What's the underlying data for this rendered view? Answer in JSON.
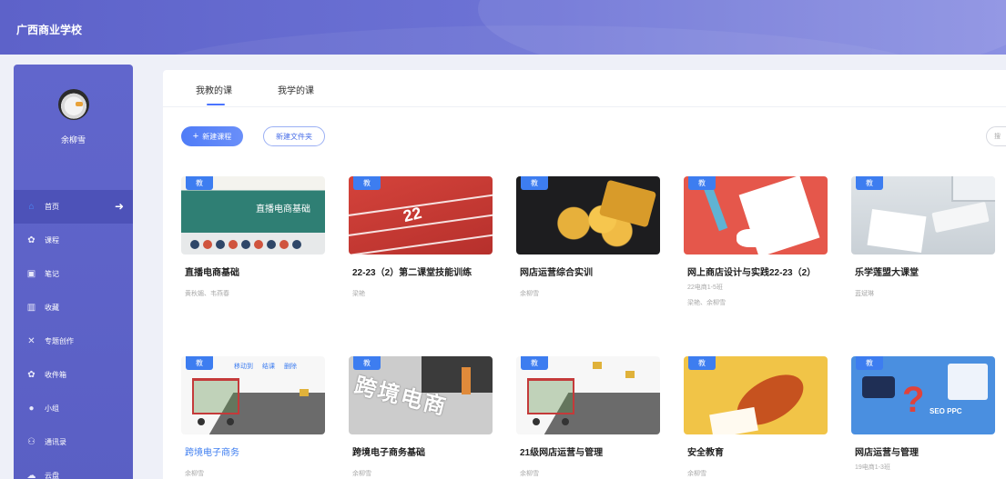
{
  "header": {
    "school_name": "广西商业学校"
  },
  "sidebar": {
    "user_name": "余柳雪",
    "items": [
      {
        "label": "首页",
        "icon": "home-icon",
        "active": true
      },
      {
        "label": "课程",
        "icon": "course-icon"
      },
      {
        "label": "笔记",
        "icon": "notes-icon"
      },
      {
        "label": "收藏",
        "icon": "favorites-icon"
      },
      {
        "label": "专题创作",
        "icon": "tools-icon"
      },
      {
        "label": "收件箱",
        "icon": "inbox-icon"
      },
      {
        "label": "小组",
        "icon": "group-icon"
      },
      {
        "label": "通讯录",
        "icon": "contacts-icon"
      },
      {
        "label": "云盘",
        "icon": "cloud-icon"
      }
    ]
  },
  "tabs": [
    {
      "label": "我教的课",
      "active": true
    },
    {
      "label": "我学的课"
    }
  ],
  "toolbar": {
    "new_course": "新建课程",
    "new_folder": "新建文件夹",
    "search_placeholder": "搜"
  },
  "badge_label": "教",
  "card_actions": [
    "移动到",
    "结课",
    "删除"
  ],
  "courses": [
    {
      "title": "直播电商基础",
      "thumb_text": "直播电商基础",
      "teachers": "黄秋媚、韦燕春"
    },
    {
      "title": "22-23（2）第二课堂技能训练",
      "thumb_text": "22",
      "teachers": "梁艳"
    },
    {
      "title": "网店运营综合实训",
      "teachers": "余柳雪"
    },
    {
      "title": "网上商店设计与实践22-23（2）",
      "class": "22电商1-5班",
      "teachers": "梁艳、余柳雪"
    },
    {
      "title": "乐学莲盟大课堂",
      "teachers": "蓝斌琳"
    },
    {
      "title": "跨境电子商务",
      "teachers": "余柳雪"
    },
    {
      "title": "跨境电子商务基础",
      "thumb_text": "跨境电商",
      "teachers": "余柳雪"
    },
    {
      "title": "21级网店运营与管理",
      "teachers": "余柳雪"
    },
    {
      "title": "安全教育",
      "teachers": "余柳雪"
    },
    {
      "title": "网店运营与管理",
      "class": "19电商1-3班",
      "thumb_text": "SEO PPC"
    }
  ]
}
